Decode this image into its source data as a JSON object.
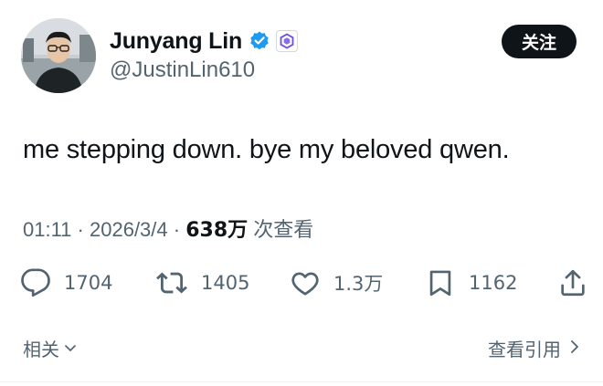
{
  "author": {
    "display_name": "Junyang Lin",
    "handle": "@JustinLin610",
    "verified_icon": "verified-badge-icon",
    "affiliation_icon": "qwen-logo-icon"
  },
  "follow_button": {
    "label": "关注"
  },
  "tweet": {
    "text": "me stepping down. bye my beloved qwen.",
    "time": "01:11",
    "separator": "·",
    "date": "2026/3/4",
    "views_count": "638万",
    "views_label": "次查看"
  },
  "actions": {
    "reply": {
      "icon": "reply-icon",
      "count": "1704"
    },
    "retweet": {
      "icon": "retweet-icon",
      "count": "1405"
    },
    "like": {
      "icon": "heart-icon",
      "count": "1.3万"
    },
    "bookmark": {
      "icon": "bookmark-icon",
      "count": "1162"
    },
    "share": {
      "icon": "share-icon"
    }
  },
  "footer": {
    "related_label": "相关",
    "quotes_label": "查看引用"
  },
  "colors": {
    "text": "#0f1419",
    "secondary": "#536471",
    "verified": "#1d9bf0",
    "button_bg": "#0f1419"
  }
}
